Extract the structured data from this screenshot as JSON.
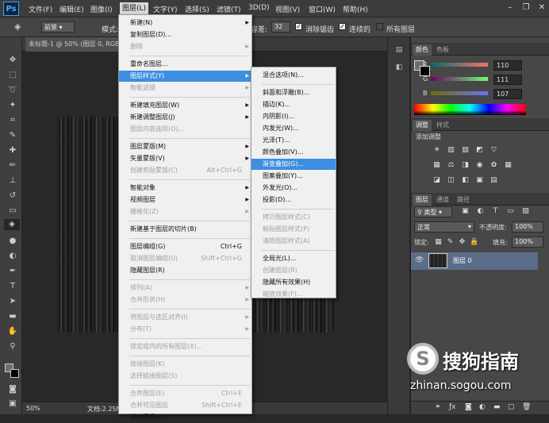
{
  "app": {
    "logo": "Ps"
  },
  "menubar": {
    "items": [
      "文件(F)",
      "编辑(E)",
      "图像(I)",
      "图层(L)",
      "文字(Y)",
      "选择(S)",
      "滤镜(T)",
      "3D(D)",
      "视图(V)",
      "窗口(W)",
      "帮助(H)"
    ],
    "active": "图层(L)"
  },
  "window_controls": {
    "minimize": "–",
    "restore": "❐",
    "close": "✕"
  },
  "options": {
    "preset_label": "前景",
    "mode_label": "模式:",
    "tolerance_label": "容差:",
    "tolerance_value": "32",
    "antialias_label": "消除锯齿",
    "contiguous_label": "连续的",
    "all_layers_label": "所有图层"
  },
  "document": {
    "tab_title": "未标题-1 @ 50% (图层 0, RGB/8)"
  },
  "status": {
    "zoom": "50%",
    "doc_info": "文档:2.25M/"
  },
  "menu_layer": {
    "items": [
      {
        "label": "新建(N)",
        "arrow": true
      },
      {
        "label": "复制图层(D)..."
      },
      {
        "label": "删除",
        "disabled": true,
        "arrow": true
      },
      {
        "sep": true
      },
      {
        "label": "重命名图层..."
      },
      {
        "label": "图层样式(Y)",
        "arrow": true,
        "highlight": true
      },
      {
        "label": "智能滤镜",
        "disabled": true,
        "arrow": true
      },
      {
        "sep": true
      },
      {
        "label": "新建填充图层(W)",
        "arrow": true
      },
      {
        "label": "新建调整图层(J)",
        "arrow": true
      },
      {
        "label": "图层内容选项(O)...",
        "disabled": true
      },
      {
        "sep": true
      },
      {
        "label": "图层蒙版(M)",
        "arrow": true
      },
      {
        "label": "矢量蒙版(V)",
        "arrow": true
      },
      {
        "label": "创建剪贴蒙版(C)",
        "disabled": true,
        "shortcut": "Alt+Ctrl+G"
      },
      {
        "sep": true
      },
      {
        "label": "智能对象",
        "arrow": true
      },
      {
        "label": "视频图层",
        "arrow": true
      },
      {
        "label": "栅格化(Z)",
        "disabled": true,
        "arrow": true
      },
      {
        "sep": true
      },
      {
        "label": "新建基于图层的切片(B)"
      },
      {
        "sep": true
      },
      {
        "label": "图层编组(G)",
        "shortcut": "Ctrl+G"
      },
      {
        "label": "取消图层编组(U)",
        "disabled": true,
        "shortcut": "Shift+Ctrl+G"
      },
      {
        "label": "隐藏图层(R)"
      },
      {
        "sep": true
      },
      {
        "label": "排列(A)",
        "disabled": true,
        "arrow": true
      },
      {
        "label": "合并形状(H)",
        "disabled": true,
        "arrow": true
      },
      {
        "sep": true
      },
      {
        "label": "将图层与选区对齐(I)",
        "disabled": true,
        "arrow": true
      },
      {
        "label": "分布(T)",
        "disabled": true,
        "arrow": true
      },
      {
        "sep": true
      },
      {
        "label": "锁定组内的所有图层(X)...",
        "disabled": true
      },
      {
        "sep": true
      },
      {
        "label": "链接图层(K)",
        "disabled": true
      },
      {
        "label": "选择链接图层(S)",
        "disabled": true
      },
      {
        "sep": true
      },
      {
        "label": "合并图层(E)",
        "disabled": true,
        "shortcut": "Ctrl+E"
      },
      {
        "label": "合并可见图层",
        "disabled": true,
        "shortcut": "Shift+Ctrl+E"
      },
      {
        "label": "拼合图像(F)"
      }
    ]
  },
  "menu_style": {
    "items": [
      {
        "label": "混合选项(N)..."
      },
      {
        "sep": true
      },
      {
        "label": "斜面和浮雕(B)..."
      },
      {
        "label": "描边(K)..."
      },
      {
        "label": "内阴影(I)..."
      },
      {
        "label": "内发光(W)..."
      },
      {
        "label": "光泽(T)..."
      },
      {
        "label": "颜色叠加(V)..."
      },
      {
        "label": "渐变叠加(G)...",
        "highlight": true
      },
      {
        "label": "图案叠加(Y)..."
      },
      {
        "label": "外发光(O)..."
      },
      {
        "label": "投影(D)..."
      },
      {
        "sep": true
      },
      {
        "label": "拷贝图层样式(C)",
        "disabled": true
      },
      {
        "label": "粘贴图层样式(P)",
        "disabled": true
      },
      {
        "label": "清除图层样式(A)",
        "disabled": true
      },
      {
        "sep": true
      },
      {
        "label": "全局光(L)..."
      },
      {
        "label": "创建图层(R)",
        "disabled": true
      },
      {
        "label": "隐藏所有效果(H)"
      },
      {
        "label": "缩放效果(F)...",
        "disabled": true
      }
    ]
  },
  "color_panel": {
    "tabs": [
      "颜色",
      "色板"
    ],
    "channels": [
      {
        "label": "R",
        "value": "110"
      },
      {
        "label": "G",
        "value": "111"
      },
      {
        "label": "B",
        "value": "107"
      }
    ]
  },
  "adjust_panel": {
    "tabs": [
      "调整",
      "样式"
    ],
    "title": "添加调整"
  },
  "layers_panel": {
    "tabs": [
      "图层",
      "通道",
      "路径"
    ],
    "filter_label": "类型",
    "blend_mode": "正常",
    "opacity_label": "不透明度:",
    "opacity_value": "100%",
    "lock_label": "锁定:",
    "fill_label": "填充:",
    "fill_value": "100%",
    "layer_name": "图层 0"
  },
  "watermark": {
    "logo": "S",
    "brand": "搜狗指南",
    "url": "zhinan.sogou.com"
  },
  "colors": {
    "highlight": "#3d8ee0",
    "panel": "#474747",
    "layer_selected": "#5b6d88"
  }
}
